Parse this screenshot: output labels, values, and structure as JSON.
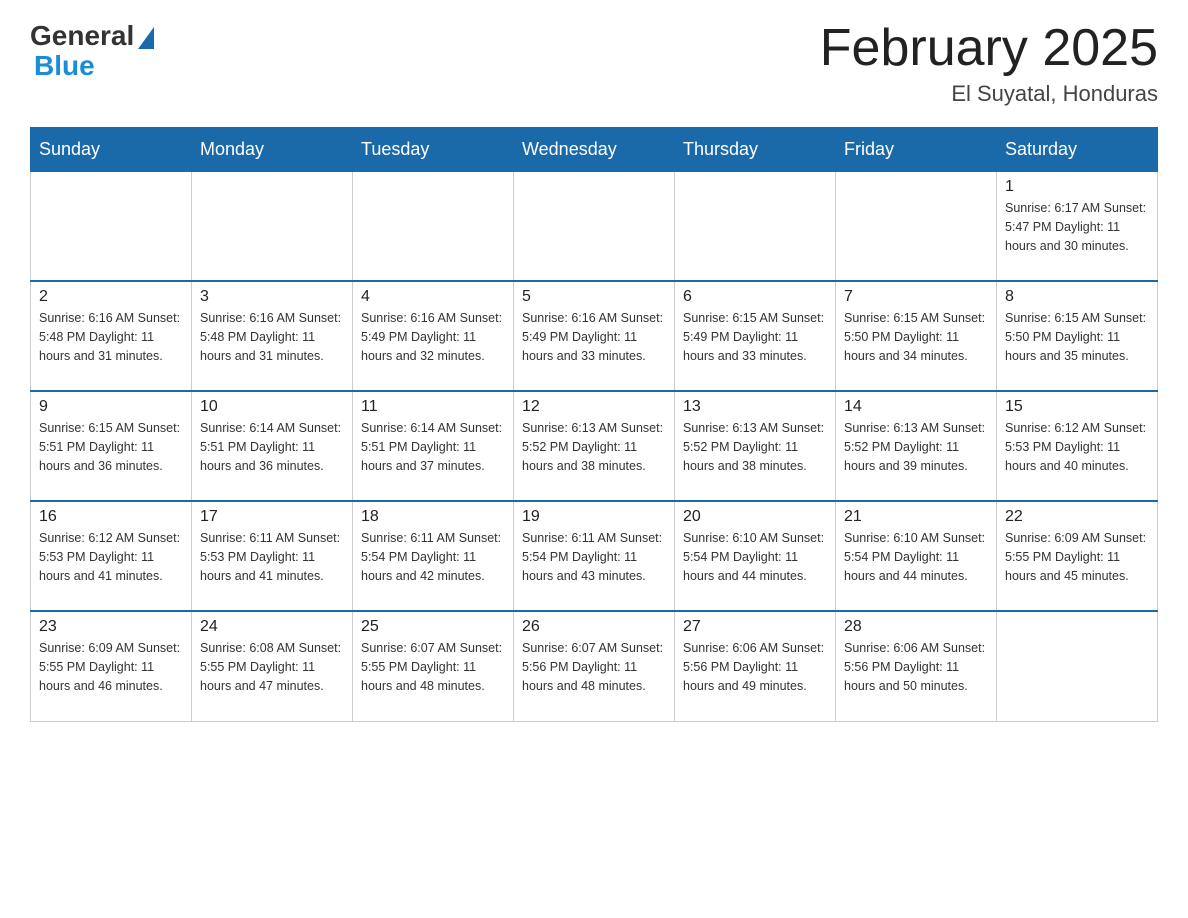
{
  "logo": {
    "general": "General",
    "blue": "Blue"
  },
  "header": {
    "title": "February 2025",
    "location": "El Suyatal, Honduras"
  },
  "weekdays": [
    "Sunday",
    "Monday",
    "Tuesday",
    "Wednesday",
    "Thursday",
    "Friday",
    "Saturday"
  ],
  "weeks": [
    [
      {
        "day": "",
        "info": ""
      },
      {
        "day": "",
        "info": ""
      },
      {
        "day": "",
        "info": ""
      },
      {
        "day": "",
        "info": ""
      },
      {
        "day": "",
        "info": ""
      },
      {
        "day": "",
        "info": ""
      },
      {
        "day": "1",
        "info": "Sunrise: 6:17 AM\nSunset: 5:47 PM\nDaylight: 11 hours and 30 minutes."
      }
    ],
    [
      {
        "day": "2",
        "info": "Sunrise: 6:16 AM\nSunset: 5:48 PM\nDaylight: 11 hours and 31 minutes."
      },
      {
        "day": "3",
        "info": "Sunrise: 6:16 AM\nSunset: 5:48 PM\nDaylight: 11 hours and 31 minutes."
      },
      {
        "day": "4",
        "info": "Sunrise: 6:16 AM\nSunset: 5:49 PM\nDaylight: 11 hours and 32 minutes."
      },
      {
        "day": "5",
        "info": "Sunrise: 6:16 AM\nSunset: 5:49 PM\nDaylight: 11 hours and 33 minutes."
      },
      {
        "day": "6",
        "info": "Sunrise: 6:15 AM\nSunset: 5:49 PM\nDaylight: 11 hours and 33 minutes."
      },
      {
        "day": "7",
        "info": "Sunrise: 6:15 AM\nSunset: 5:50 PM\nDaylight: 11 hours and 34 minutes."
      },
      {
        "day": "8",
        "info": "Sunrise: 6:15 AM\nSunset: 5:50 PM\nDaylight: 11 hours and 35 minutes."
      }
    ],
    [
      {
        "day": "9",
        "info": "Sunrise: 6:15 AM\nSunset: 5:51 PM\nDaylight: 11 hours and 36 minutes."
      },
      {
        "day": "10",
        "info": "Sunrise: 6:14 AM\nSunset: 5:51 PM\nDaylight: 11 hours and 36 minutes."
      },
      {
        "day": "11",
        "info": "Sunrise: 6:14 AM\nSunset: 5:51 PM\nDaylight: 11 hours and 37 minutes."
      },
      {
        "day": "12",
        "info": "Sunrise: 6:13 AM\nSunset: 5:52 PM\nDaylight: 11 hours and 38 minutes."
      },
      {
        "day": "13",
        "info": "Sunrise: 6:13 AM\nSunset: 5:52 PM\nDaylight: 11 hours and 38 minutes."
      },
      {
        "day": "14",
        "info": "Sunrise: 6:13 AM\nSunset: 5:52 PM\nDaylight: 11 hours and 39 minutes."
      },
      {
        "day": "15",
        "info": "Sunrise: 6:12 AM\nSunset: 5:53 PM\nDaylight: 11 hours and 40 minutes."
      }
    ],
    [
      {
        "day": "16",
        "info": "Sunrise: 6:12 AM\nSunset: 5:53 PM\nDaylight: 11 hours and 41 minutes."
      },
      {
        "day": "17",
        "info": "Sunrise: 6:11 AM\nSunset: 5:53 PM\nDaylight: 11 hours and 41 minutes."
      },
      {
        "day": "18",
        "info": "Sunrise: 6:11 AM\nSunset: 5:54 PM\nDaylight: 11 hours and 42 minutes."
      },
      {
        "day": "19",
        "info": "Sunrise: 6:11 AM\nSunset: 5:54 PM\nDaylight: 11 hours and 43 minutes."
      },
      {
        "day": "20",
        "info": "Sunrise: 6:10 AM\nSunset: 5:54 PM\nDaylight: 11 hours and 44 minutes."
      },
      {
        "day": "21",
        "info": "Sunrise: 6:10 AM\nSunset: 5:54 PM\nDaylight: 11 hours and 44 minutes."
      },
      {
        "day": "22",
        "info": "Sunrise: 6:09 AM\nSunset: 5:55 PM\nDaylight: 11 hours and 45 minutes."
      }
    ],
    [
      {
        "day": "23",
        "info": "Sunrise: 6:09 AM\nSunset: 5:55 PM\nDaylight: 11 hours and 46 minutes."
      },
      {
        "day": "24",
        "info": "Sunrise: 6:08 AM\nSunset: 5:55 PM\nDaylight: 11 hours and 47 minutes."
      },
      {
        "day": "25",
        "info": "Sunrise: 6:07 AM\nSunset: 5:55 PM\nDaylight: 11 hours and 48 minutes."
      },
      {
        "day": "26",
        "info": "Sunrise: 6:07 AM\nSunset: 5:56 PM\nDaylight: 11 hours and 48 minutes."
      },
      {
        "day": "27",
        "info": "Sunrise: 6:06 AM\nSunset: 5:56 PM\nDaylight: 11 hours and 49 minutes."
      },
      {
        "day": "28",
        "info": "Sunrise: 6:06 AM\nSunset: 5:56 PM\nDaylight: 11 hours and 50 minutes."
      },
      {
        "day": "",
        "info": ""
      }
    ]
  ]
}
